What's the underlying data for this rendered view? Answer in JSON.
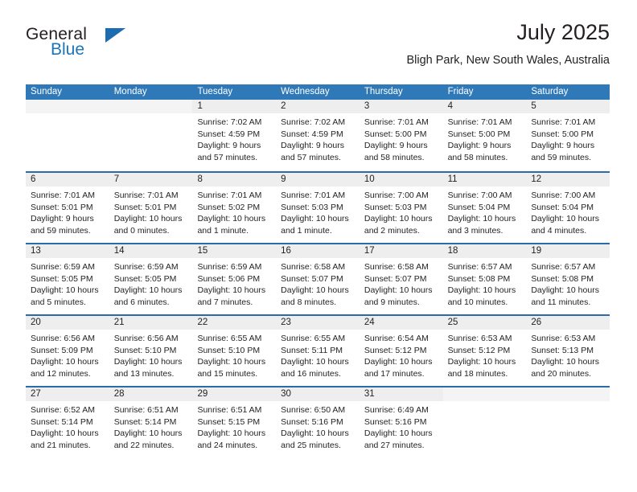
{
  "brand": {
    "name_part1": "General",
    "name_part2": "Blue",
    "logo_icon": "triangle-flag-icon",
    "accent_color": "#1b75bb"
  },
  "header": {
    "title": "July 2025",
    "subtitle": "Bligh Park, New South Wales, Australia"
  },
  "calendar": {
    "header_bg": "#3079b8",
    "row_divider_color": "#2a6ca8",
    "daynum_bg": "#eeeeee",
    "weekdays": [
      "Sunday",
      "Monday",
      "Tuesday",
      "Wednesday",
      "Thursday",
      "Friday",
      "Saturday"
    ],
    "weeks": [
      [
        {
          "day": "",
          "lines": []
        },
        {
          "day": "",
          "lines": []
        },
        {
          "day": "1",
          "lines": [
            "Sunrise: 7:02 AM",
            "Sunset: 4:59 PM",
            "Daylight: 9 hours",
            "and 57 minutes."
          ]
        },
        {
          "day": "2",
          "lines": [
            "Sunrise: 7:02 AM",
            "Sunset: 4:59 PM",
            "Daylight: 9 hours",
            "and 57 minutes."
          ]
        },
        {
          "day": "3",
          "lines": [
            "Sunrise: 7:01 AM",
            "Sunset: 5:00 PM",
            "Daylight: 9 hours",
            "and 58 minutes."
          ]
        },
        {
          "day": "4",
          "lines": [
            "Sunrise: 7:01 AM",
            "Sunset: 5:00 PM",
            "Daylight: 9 hours",
            "and 58 minutes."
          ]
        },
        {
          "day": "5",
          "lines": [
            "Sunrise: 7:01 AM",
            "Sunset: 5:00 PM",
            "Daylight: 9 hours",
            "and 59 minutes."
          ]
        }
      ],
      [
        {
          "day": "6",
          "lines": [
            "Sunrise: 7:01 AM",
            "Sunset: 5:01 PM",
            "Daylight: 9 hours",
            "and 59 minutes."
          ]
        },
        {
          "day": "7",
          "lines": [
            "Sunrise: 7:01 AM",
            "Sunset: 5:01 PM",
            "Daylight: 10 hours",
            "and 0 minutes."
          ]
        },
        {
          "day": "8",
          "lines": [
            "Sunrise: 7:01 AM",
            "Sunset: 5:02 PM",
            "Daylight: 10 hours",
            "and 1 minute."
          ]
        },
        {
          "day": "9",
          "lines": [
            "Sunrise: 7:01 AM",
            "Sunset: 5:03 PM",
            "Daylight: 10 hours",
            "and 1 minute."
          ]
        },
        {
          "day": "10",
          "lines": [
            "Sunrise: 7:00 AM",
            "Sunset: 5:03 PM",
            "Daylight: 10 hours",
            "and 2 minutes."
          ]
        },
        {
          "day": "11",
          "lines": [
            "Sunrise: 7:00 AM",
            "Sunset: 5:04 PM",
            "Daylight: 10 hours",
            "and 3 minutes."
          ]
        },
        {
          "day": "12",
          "lines": [
            "Sunrise: 7:00 AM",
            "Sunset: 5:04 PM",
            "Daylight: 10 hours",
            "and 4 minutes."
          ]
        }
      ],
      [
        {
          "day": "13",
          "lines": [
            "Sunrise: 6:59 AM",
            "Sunset: 5:05 PM",
            "Daylight: 10 hours",
            "and 5 minutes."
          ]
        },
        {
          "day": "14",
          "lines": [
            "Sunrise: 6:59 AM",
            "Sunset: 5:05 PM",
            "Daylight: 10 hours",
            "and 6 minutes."
          ]
        },
        {
          "day": "15",
          "lines": [
            "Sunrise: 6:59 AM",
            "Sunset: 5:06 PM",
            "Daylight: 10 hours",
            "and 7 minutes."
          ]
        },
        {
          "day": "16",
          "lines": [
            "Sunrise: 6:58 AM",
            "Sunset: 5:07 PM",
            "Daylight: 10 hours",
            "and 8 minutes."
          ]
        },
        {
          "day": "17",
          "lines": [
            "Sunrise: 6:58 AM",
            "Sunset: 5:07 PM",
            "Daylight: 10 hours",
            "and 9 minutes."
          ]
        },
        {
          "day": "18",
          "lines": [
            "Sunrise: 6:57 AM",
            "Sunset: 5:08 PM",
            "Daylight: 10 hours",
            "and 10 minutes."
          ]
        },
        {
          "day": "19",
          "lines": [
            "Sunrise: 6:57 AM",
            "Sunset: 5:08 PM",
            "Daylight: 10 hours",
            "and 11 minutes."
          ]
        }
      ],
      [
        {
          "day": "20",
          "lines": [
            "Sunrise: 6:56 AM",
            "Sunset: 5:09 PM",
            "Daylight: 10 hours",
            "and 12 minutes."
          ]
        },
        {
          "day": "21",
          "lines": [
            "Sunrise: 6:56 AM",
            "Sunset: 5:10 PM",
            "Daylight: 10 hours",
            "and 13 minutes."
          ]
        },
        {
          "day": "22",
          "lines": [
            "Sunrise: 6:55 AM",
            "Sunset: 5:10 PM",
            "Daylight: 10 hours",
            "and 15 minutes."
          ]
        },
        {
          "day": "23",
          "lines": [
            "Sunrise: 6:55 AM",
            "Sunset: 5:11 PM",
            "Daylight: 10 hours",
            "and 16 minutes."
          ]
        },
        {
          "day": "24",
          "lines": [
            "Sunrise: 6:54 AM",
            "Sunset: 5:12 PM",
            "Daylight: 10 hours",
            "and 17 minutes."
          ]
        },
        {
          "day": "25",
          "lines": [
            "Sunrise: 6:53 AM",
            "Sunset: 5:12 PM",
            "Daylight: 10 hours",
            "and 18 minutes."
          ]
        },
        {
          "day": "26",
          "lines": [
            "Sunrise: 6:53 AM",
            "Sunset: 5:13 PM",
            "Daylight: 10 hours",
            "and 20 minutes."
          ]
        }
      ],
      [
        {
          "day": "27",
          "lines": [
            "Sunrise: 6:52 AM",
            "Sunset: 5:14 PM",
            "Daylight: 10 hours",
            "and 21 minutes."
          ]
        },
        {
          "day": "28",
          "lines": [
            "Sunrise: 6:51 AM",
            "Sunset: 5:14 PM",
            "Daylight: 10 hours",
            "and 22 minutes."
          ]
        },
        {
          "day": "29",
          "lines": [
            "Sunrise: 6:51 AM",
            "Sunset: 5:15 PM",
            "Daylight: 10 hours",
            "and 24 minutes."
          ]
        },
        {
          "day": "30",
          "lines": [
            "Sunrise: 6:50 AM",
            "Sunset: 5:16 PM",
            "Daylight: 10 hours",
            "and 25 minutes."
          ]
        },
        {
          "day": "31",
          "lines": [
            "Sunrise: 6:49 AM",
            "Sunset: 5:16 PM",
            "Daylight: 10 hours",
            "and 27 minutes."
          ]
        },
        {
          "day": "",
          "lines": []
        },
        {
          "day": "",
          "lines": []
        }
      ]
    ]
  }
}
